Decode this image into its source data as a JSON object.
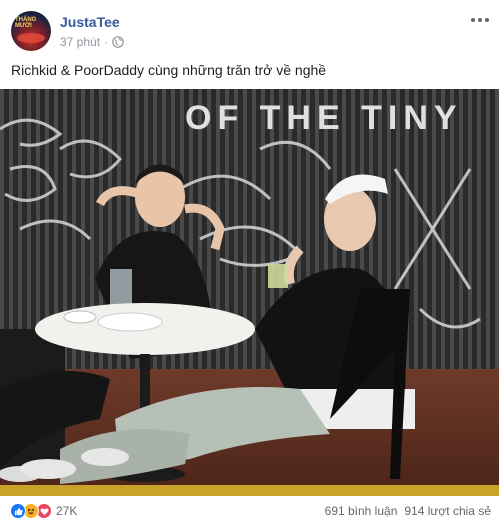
{
  "post": {
    "author": "JustaTee",
    "avatar_text": "THÁNG MƯỜI",
    "time": "37 phút",
    "privacy_icon": "globe-icon",
    "caption": "Richkid & PoorDaddy cùng những trăn trở về nghề",
    "photo_sign_text": "OF THE TINY"
  },
  "footer": {
    "reaction_icons": [
      "like-icon",
      "haha-icon",
      "love-icon"
    ],
    "reaction_count": "27K",
    "comments": "691 bình luận",
    "shares": "914 lượt chia sẻ"
  },
  "colors": {
    "author_link": "#385898",
    "meta_gray": "#90949c",
    "like_blue": "#1877f2",
    "haha_yellow": "#f7b125",
    "love_red": "#e8475f"
  }
}
